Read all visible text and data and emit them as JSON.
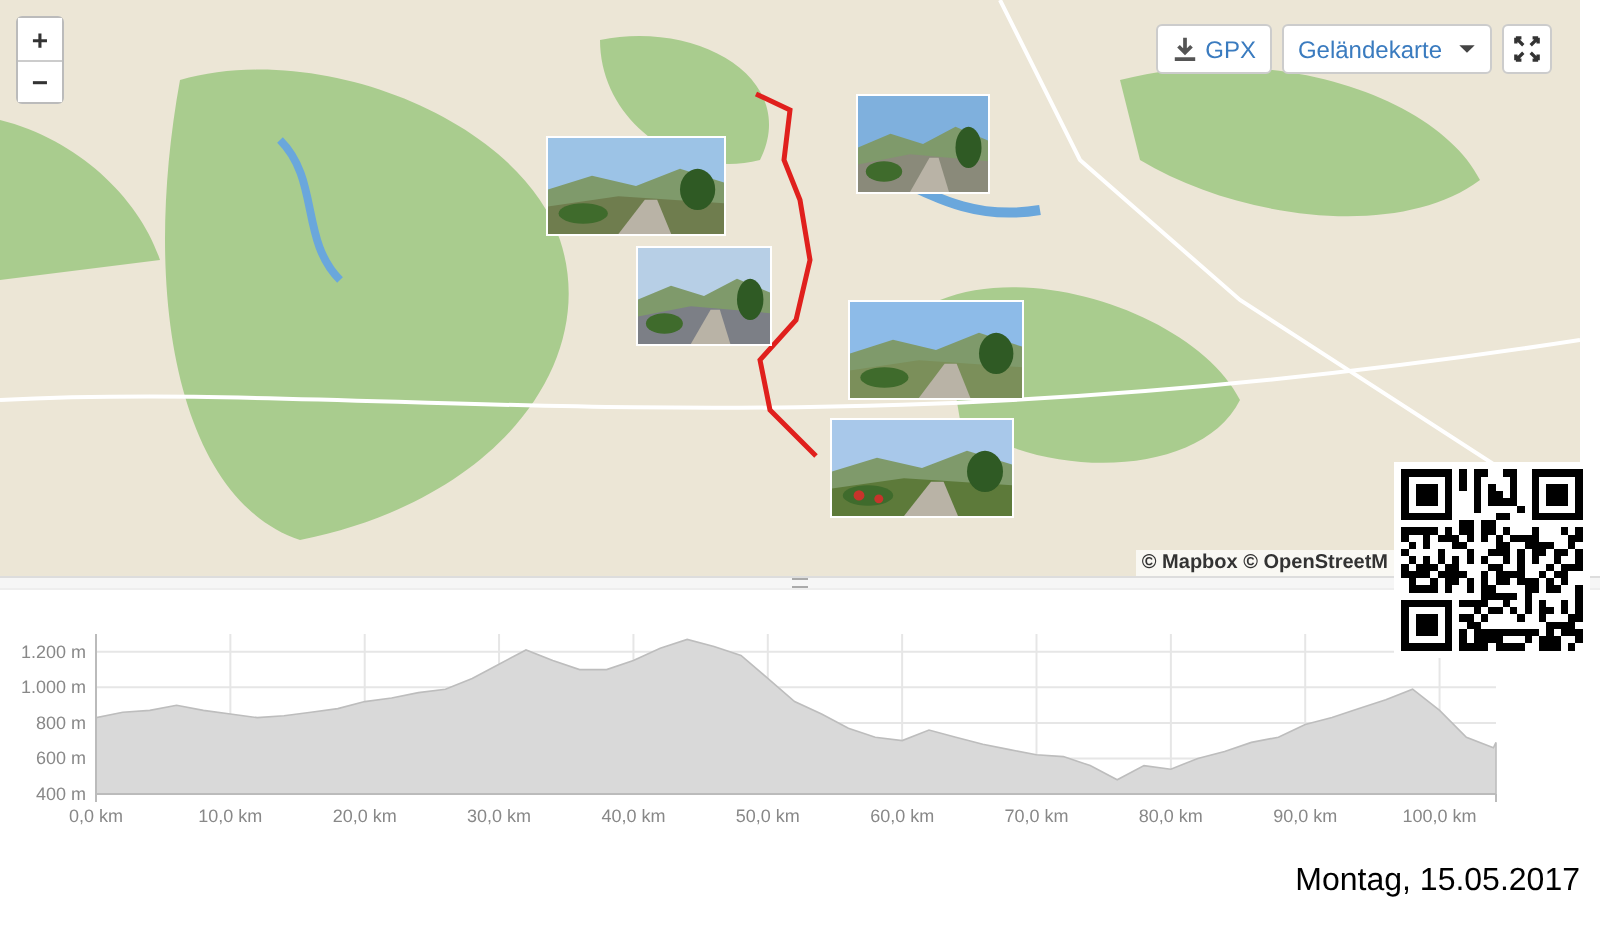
{
  "map": {
    "zoom_in": "+",
    "zoom_out": "−",
    "gpx_button": "GPX",
    "layer_select": "Geländekarte",
    "attribution": "© Mapbox © OpenStreetM"
  },
  "elevation_profile": {
    "chart_data": {
      "type": "area",
      "xlim": [
        0,
        104.2
      ],
      "ylim": [
        400,
        1300
      ],
      "xticks": [
        {
          "value": 0,
          "label": "0,0 km"
        },
        {
          "value": 10,
          "label": "10,0 km"
        },
        {
          "value": 20,
          "label": "20,0 km"
        },
        {
          "value": 30,
          "label": "30,0 km"
        },
        {
          "value": 40,
          "label": "40,0 km"
        },
        {
          "value": 50,
          "label": "50,0 km"
        },
        {
          "value": 60,
          "label": "60,0 km"
        },
        {
          "value": 70,
          "label": "70,0 km"
        },
        {
          "value": 80,
          "label": "80,0 km"
        },
        {
          "value": 90,
          "label": "90,0 km"
        },
        {
          "value": 100,
          "label": "100,0 km"
        }
      ],
      "yticks": [
        {
          "value": 400,
          "label": "400 m"
        },
        {
          "value": 600,
          "label": "600 m"
        },
        {
          "value": 800,
          "label": "800 m"
        },
        {
          "value": 1000,
          "label": "1.000 m"
        },
        {
          "value": 1200,
          "label": "1.200 m"
        }
      ],
      "x": [
        0,
        2,
        4,
        6,
        8,
        10,
        12,
        14,
        16,
        18,
        20,
        22,
        24,
        26,
        28,
        30,
        32,
        34,
        36,
        38,
        40,
        42,
        44,
        46,
        48,
        50,
        52,
        54,
        56,
        58,
        60,
        62,
        64,
        66,
        68,
        70,
        72,
        74,
        76,
        78,
        80,
        82,
        84,
        86,
        88,
        90,
        92,
        94,
        96,
        98,
        100,
        102,
        104,
        104.2
      ],
      "grid": true,
      "series": [
        {
          "color": "#d9d9d9",
          "values": [
            830,
            860,
            870,
            900,
            870,
            850,
            830,
            840,
            860,
            880,
            920,
            940,
            970,
            990,
            1050,
            1130,
            1210,
            1150,
            1100,
            1100,
            1150,
            1220,
            1270,
            1230,
            1180,
            1050,
            920,
            850,
            770,
            720,
            700,
            760,
            720,
            680,
            650,
            620,
            610,
            560,
            480,
            560,
            540,
            600,
            640,
            690,
            720,
            790,
            830,
            880,
            930,
            990,
            870,
            720,
            660,
            690
          ]
        }
      ]
    }
  },
  "date": "Montag, 15.05.2017"
}
